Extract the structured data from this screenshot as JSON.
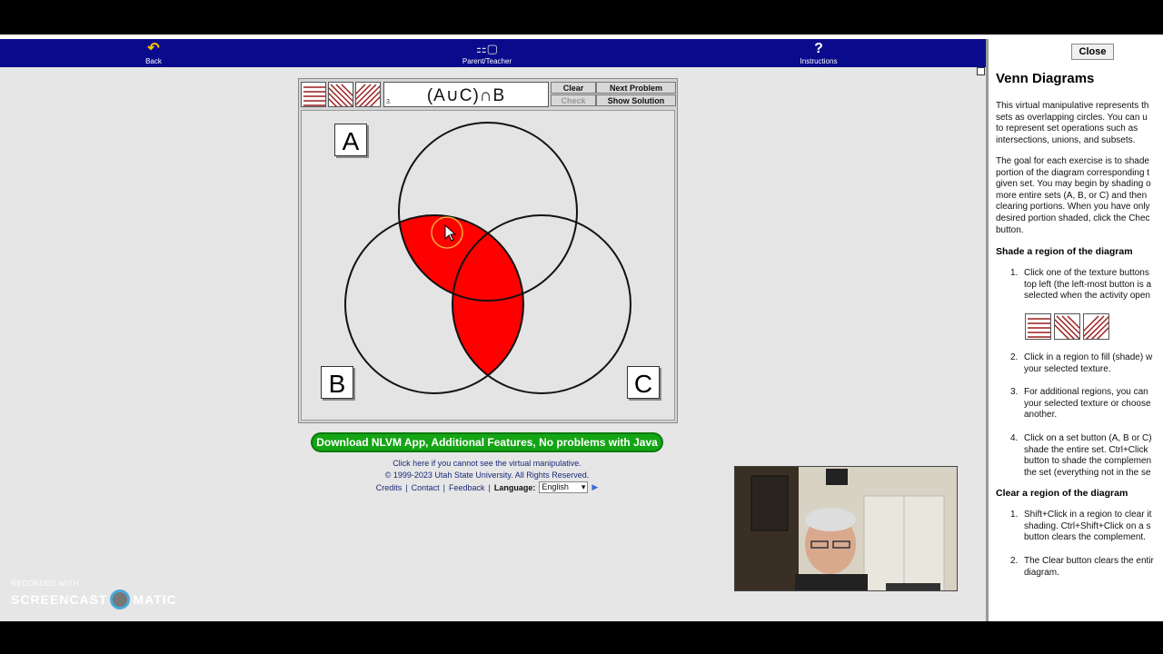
{
  "nav": {
    "back_label": "Back",
    "parent_label": "Parent/Teacher",
    "instructions_label": "Instructions"
  },
  "applet": {
    "expression": "(A∪C)∩B",
    "problem_number": "3.",
    "clear_label": "Clear",
    "check_label": "Check",
    "next_label": "Next Problem",
    "solution_label": "Show Solution",
    "set_a": "A",
    "set_b": "B",
    "set_c": "C",
    "shade_color": "#ff0000",
    "texture_color": "#9b1c1c"
  },
  "footer": {
    "download_label": "Download NLVM App, Additional Features, No problems with Java",
    "java_link": "Click here if you cannot see the virtual manipulative.",
    "copyright": "© 1999-2023 Utah State University. All Rights Reserved.",
    "credits": "Credits",
    "contact": "Contact",
    "feedback": "Feedback",
    "language_label": "Language:",
    "language_value": "English"
  },
  "watermark": {
    "recorded": "RECORDED WITH",
    "brand_left": "SCREENCAST",
    "brand_right": "MATIC"
  },
  "panel": {
    "close_label": "Close",
    "title": "Venn Diagrams",
    "intro": "This virtual manipulative represents th\nsets as overlapping circles. You can u\nto represent set operations such as\nintersections, unions, and subsets.",
    "goal": "The goal for each exercise is to shade\nportion of the diagram corresponding t\ngiven set. You may begin by shading o\nmore entire sets (A, B, or C) and then\nclearing portions. When you have only\ndesired portion shaded, click the Chec\nbutton.",
    "shade_heading": "Shade a region of the diagram",
    "shade_steps": [
      {
        "num": "1.",
        "text": "Click one of the texture buttons\ntop left (the left-most button is a\nselected when the activity open"
      },
      {
        "num": "2.",
        "text": "Click in a region to fill (shade) w\nyour selected texture."
      },
      {
        "num": "3.",
        "text": "For additional regions, you can\nyour selected texture or choose\nanother."
      },
      {
        "num": "4.",
        "text": "Click on a set button (A, B or C)\nshade the entire set. Ctrl+Click\nbutton to shade the complemen\nthe set (everything not in the se"
      }
    ],
    "clear_heading": "Clear a region of the diagram",
    "clear_steps": [
      {
        "num": "1.",
        "text": "Shift+Click in a region to clear it\nshading. Ctrl+Shift+Click on a s\nbutton clears the complement."
      },
      {
        "num": "2.",
        "text": "The Clear button clears the entir\ndiagram."
      }
    ]
  }
}
